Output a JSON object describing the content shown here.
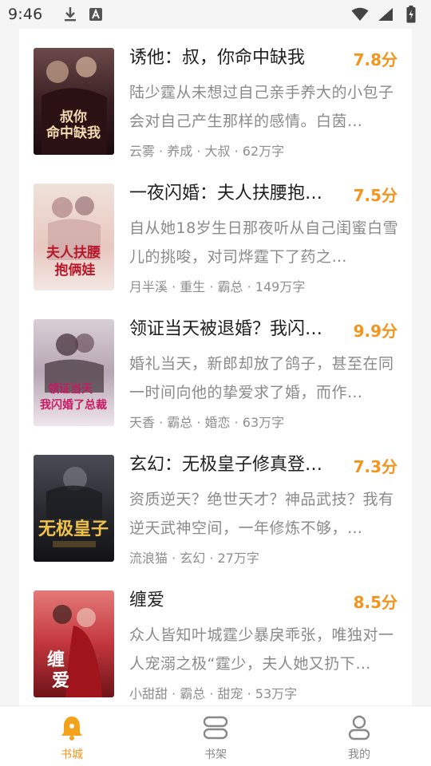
{
  "status_bar": {
    "time": "9:46"
  },
  "books": [
    {
      "title": "诱他：叔，你命中缺我",
      "score": "7.8分",
      "desc": "陆少霆从未想过自己亲手养大的小包子会对自己产生那样的感情。白茵…",
      "meta": "云雾 · 养成 · 大叔 · 62万字",
      "cover_text": "叔你命中缺我"
    },
    {
      "title": "一夜闪婚：夫人扶腰抱…",
      "score": "7.5分",
      "desc": "自从她18岁生日那夜听从自己闺蜜白雪儿的挑唆，对司烨霆下了药之…",
      "meta": "月半溪 · 重生 · 霸总 · 149万字",
      "cover_text": "夫人扶腰抱俩娃"
    },
    {
      "title": "领证当天被退婚？我闪…",
      "score": "9.9分",
      "desc": "婚礼当天，新郎却放了鸽子，甚至在同一时间向他的挚爱求了婚，而作…",
      "meta": "天香 · 霸总 · 婚恋 · 63万字",
      "cover_text": "领证当天我闪婚了总裁"
    },
    {
      "title": "玄幻：无极皇子修真登…",
      "score": "7.3分",
      "desc": "资质逆天？绝世天才？神品武技？我有逆天武神空间，一年修炼不够，…",
      "meta": "流浪猫 · 玄幻 · 27万字",
      "cover_text": "无极皇子"
    },
    {
      "title": "缠爱",
      "score": "8.5分",
      "desc": "众人皆知叶城霆少暴戾乖张，唯独对一人宠溺之极“霆少，夫人她又扔下…",
      "meta": "小甜甜 · 霸总 · 甜宠 · 53万字",
      "cover_text": "缠爱"
    }
  ],
  "bottom_nav": [
    {
      "label": "书城",
      "icon": "bell-icon",
      "active": true
    },
    {
      "label": "书架",
      "icon": "bookshelf-icon",
      "active": false
    },
    {
      "label": "我的",
      "icon": "person-icon",
      "active": false
    }
  ],
  "colors": {
    "accent": "#f3951c",
    "title": "#1f1f1f",
    "desc": "#8a8a8a",
    "background": "#f5f5f5"
  }
}
